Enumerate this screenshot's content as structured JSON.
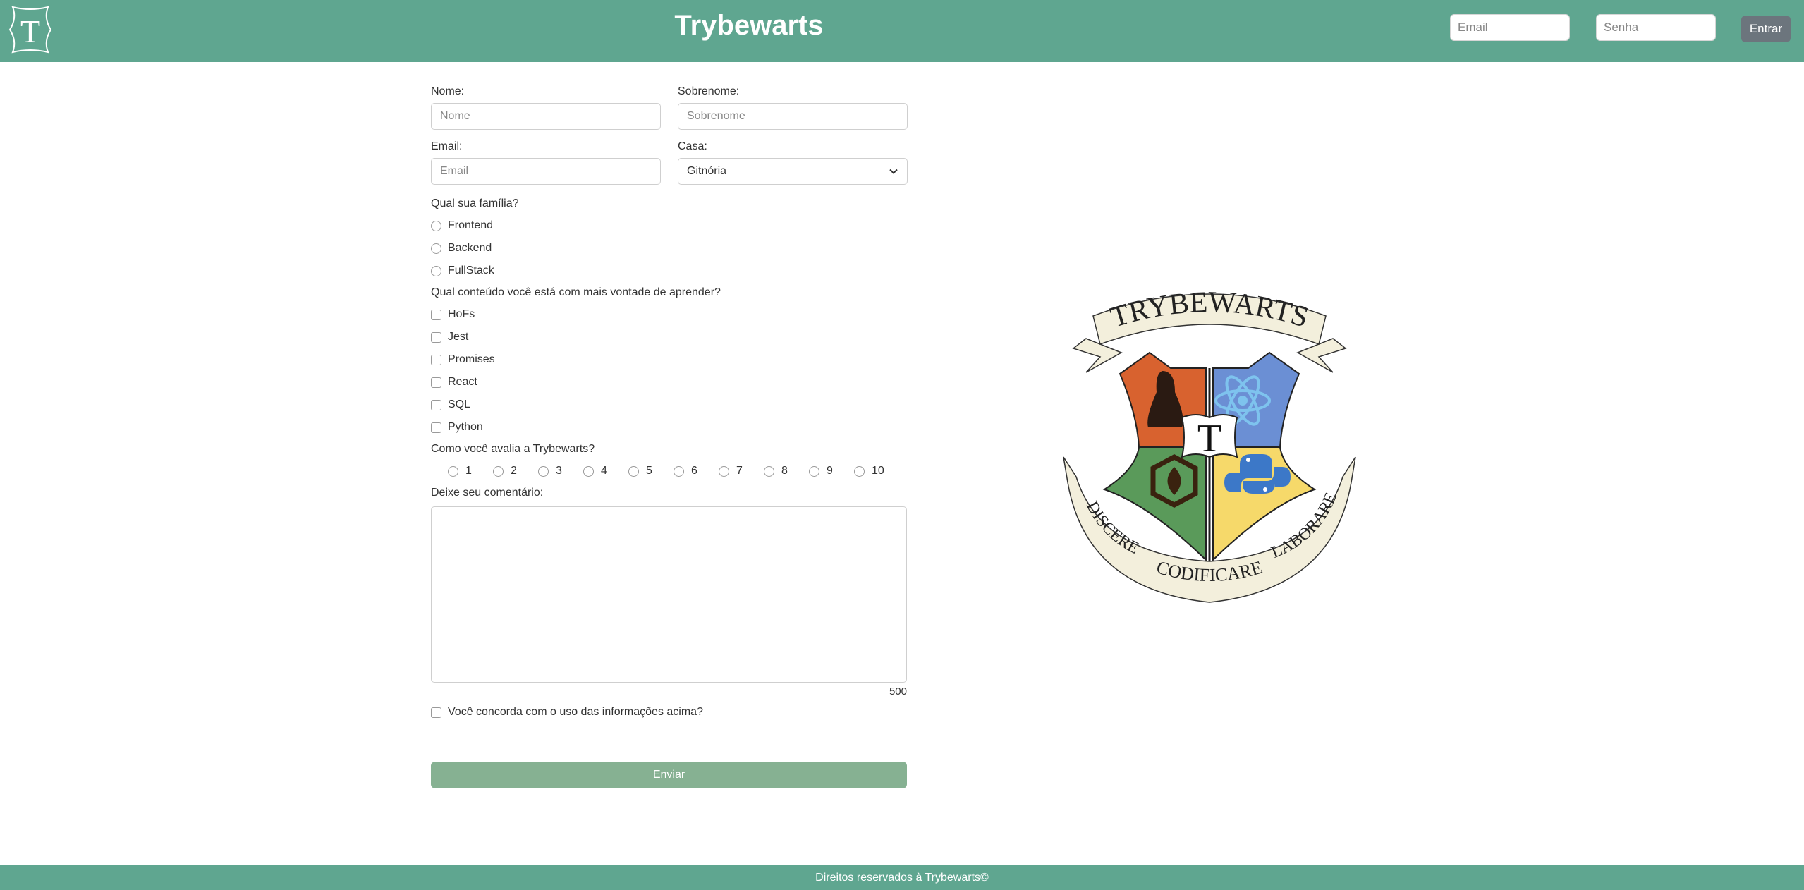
{
  "header": {
    "logo_letter": "T",
    "title": "Trybewarts",
    "email_placeholder": "Email",
    "senha_placeholder": "Senha",
    "login_button": "Entrar"
  },
  "form": {
    "nome_label": "Nome:",
    "nome_placeholder": "Nome",
    "sobrenome_label": "Sobrenome:",
    "sobrenome_placeholder": "Sobrenome",
    "email_label": "Email:",
    "email_placeholder": "Email",
    "casa_label": "Casa:",
    "casa_selected": "Gitnória",
    "familia_question": "Qual sua família?",
    "familia_options": [
      "Frontend",
      "Backend",
      "FullStack"
    ],
    "conteudo_question": "Qual conteúdo você está com mais vontade de aprender?",
    "conteudo_options": [
      "HoFs",
      "Jest",
      "Promises",
      "React",
      "SQL",
      "Python"
    ],
    "avaliacao_question": "Como você avalia a Trybewarts?",
    "avaliacao_options": [
      "1",
      "2",
      "3",
      "4",
      "5",
      "6",
      "7",
      "8",
      "9",
      "10"
    ],
    "comentario_label": "Deixe seu comentário:",
    "counter": "500",
    "agreement_label": "Você concorda com o uso das informações acima?",
    "submit_label": "Enviar"
  },
  "crest": {
    "banner_top": "TRYBEWARTS",
    "center_letter": "T",
    "motto_left": "DISCERE",
    "motto_center": "CODIFICARE",
    "motto_right": "LABORARE",
    "colors": {
      "orange": "#d8622f",
      "blue": "#6b8fd4",
      "green": "#5a9a5a",
      "yellow": "#f6d96a",
      "parchment": "#f3efdc"
    }
  },
  "footer": {
    "text": "Direitos reservados à Trybewarts©"
  },
  "theme": {
    "primary": "#5fa690",
    "submit": "#86b192",
    "login_button": "#6c757d"
  }
}
